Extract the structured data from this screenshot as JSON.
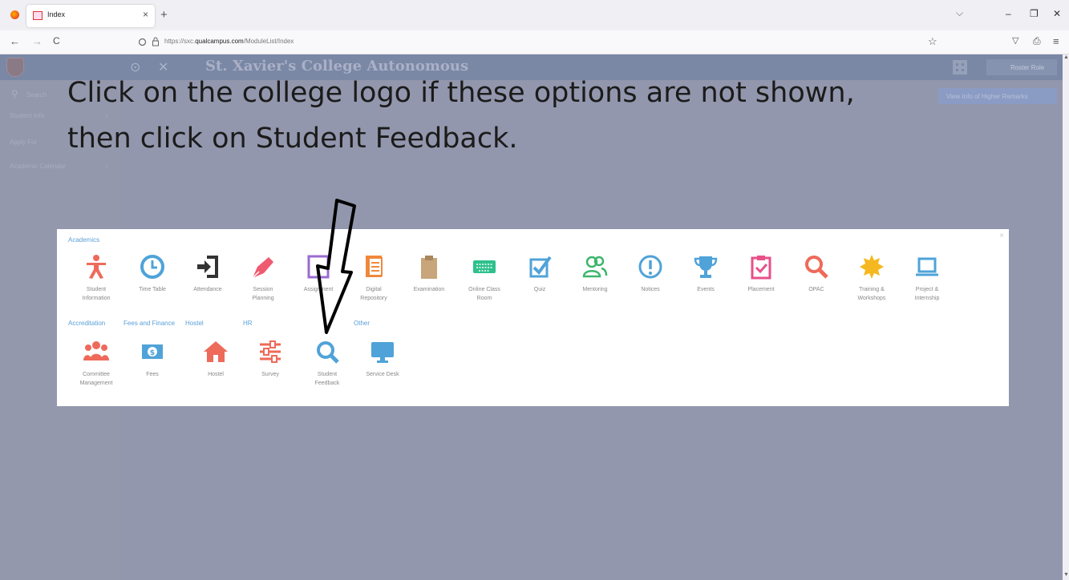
{
  "browser": {
    "tab_title": "Index",
    "tab_close": "×",
    "new_tab": "+",
    "tabs_dropdown": "⌵",
    "url_prefix": "https://sxc.",
    "url_domain": "qualcampus.com",
    "url_path": "/ModuleList/Index",
    "back": "←",
    "forward": "→",
    "reload": "C",
    "minimize": "–",
    "restore": "❐",
    "close": "✕",
    "bookmark_star": "☆",
    "pocket": "▽",
    "extensions": "⎙",
    "menu": "≡"
  },
  "app": {
    "college_name": "St. Xavier's College Autonomous",
    "header_icons": [
      "⊙",
      "✕"
    ],
    "user_button": "Roster Role",
    "banner_button": "View Info of Higher Remarks",
    "sidebar": {
      "search_icon": "⚲",
      "search_placeholder": "Search",
      "items": [
        {
          "label": "Student Info",
          "chevron": "‹"
        },
        {
          "label": "Apply For",
          "chevron": "‹"
        },
        {
          "label": "Academic Calendar",
          "chevron": "‹"
        }
      ]
    }
  },
  "instruction": {
    "line1": "Click on the college logo if these options are not shown,",
    "line2": "then click on Student Feedback."
  },
  "modal": {
    "close": "×",
    "categories": {
      "academics": "Academics",
      "accreditation": "Accreditation",
      "fees_finance": "Fees and Finance",
      "hostel": "Hostel",
      "hr": "HR",
      "other": "Other"
    },
    "academics_items": [
      {
        "line1": "Student",
        "line2": "Information",
        "icon": "person-icon",
        "color": "#ee6a5a"
      },
      {
        "line1": "Time Table",
        "line2": "",
        "icon": "clock-icon",
        "color": "#4fa3d8"
      },
      {
        "line1": "Attendance",
        "line2": "",
        "icon": "sign-in-icon",
        "color": "#333333"
      },
      {
        "line1": "Session",
        "line2": "Planning",
        "icon": "pen-icon",
        "color": "#ee5a6f"
      },
      {
        "line1": "Assignment",
        "line2": "",
        "icon": "assignment-icon",
        "color": "#9b6bd1"
      },
      {
        "line1": "Digital",
        "line2": "Repository",
        "icon": "document-icon",
        "color": "#f0883c"
      },
      {
        "line1": "Examination",
        "line2": "",
        "icon": "clipboard-icon",
        "color": "#c8a57a"
      },
      {
        "line1": "Online Class",
        "line2": "Room",
        "icon": "keyboard-icon",
        "color": "#2fc18c"
      },
      {
        "line1": "Quiz",
        "line2": "",
        "icon": "checkbox-icon",
        "color": "#4fa3d8"
      },
      {
        "line1": "Mentoring",
        "line2": "",
        "icon": "users-icon",
        "color": "#3cb66c"
      },
      {
        "line1": "Notices",
        "line2": "",
        "icon": "exclamation-icon",
        "color": "#4fa3d8"
      },
      {
        "line1": "Events",
        "line2": "",
        "icon": "trophy-icon",
        "color": "#4fa3d8"
      },
      {
        "line1": "Placement",
        "line2": "",
        "icon": "clipboard-check-icon",
        "color": "#e8508a"
      },
      {
        "line1": "OPAC",
        "line2": "",
        "icon": "search-icon",
        "color": "#ee6a5a"
      },
      {
        "line1": "Training &",
        "line2": "Workshops",
        "icon": "sun-icon",
        "color": "#f5b820"
      },
      {
        "line1": "Project &",
        "line2": "Internship",
        "icon": "laptop-icon",
        "color": "#4fa3d8"
      }
    ],
    "second_row_items": [
      {
        "line1": "Committee",
        "line2": "Management",
        "icon": "group-icon",
        "color": "#ee6a5a"
      },
      {
        "line1": "Fees",
        "line2": "",
        "icon": "money-icon",
        "color": "#4fa3d8"
      },
      {
        "line1": "Hostel",
        "line2": "",
        "icon": "home-icon",
        "color": "#ee6a5a"
      },
      {
        "line1": "Survey",
        "line2": "",
        "icon": "sliders-icon",
        "color": "#ee6a5a"
      },
      {
        "line1": "Student",
        "line2": "Feedback",
        "icon": "search-icon",
        "color": "#4fa3d8"
      },
      {
        "line1": "Service Desk",
        "line2": "",
        "icon": "monitor-icon",
        "color": "#4fa3d8"
      }
    ]
  }
}
